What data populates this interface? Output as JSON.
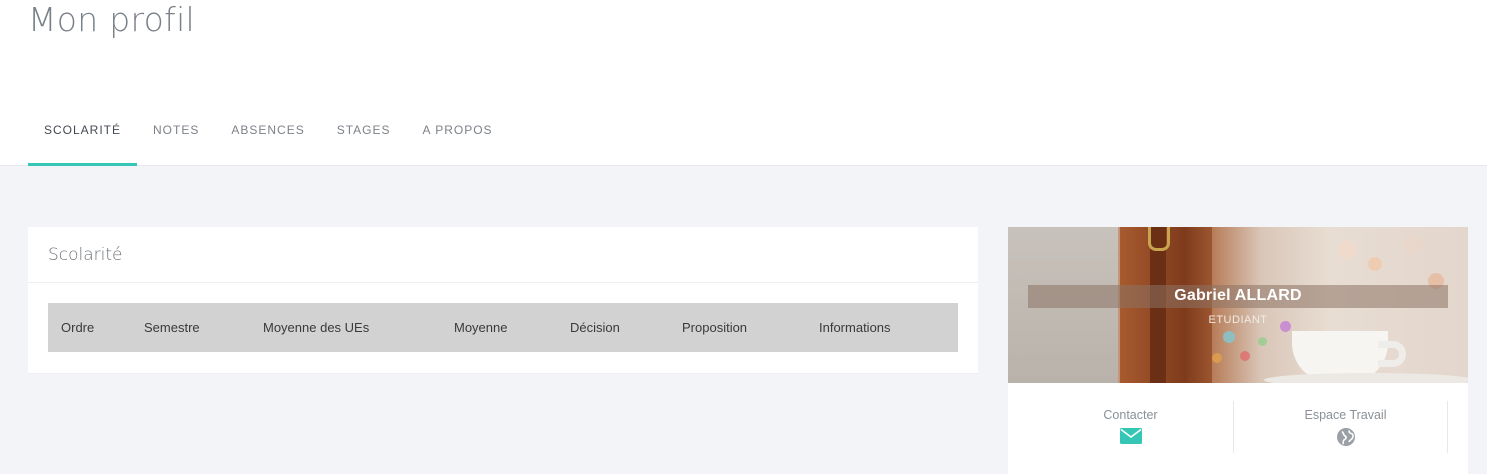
{
  "page": {
    "title": "Mon profil"
  },
  "tabs": [
    {
      "label": "SCOLARITÉ",
      "active": true
    },
    {
      "label": "NOTES",
      "active": false
    },
    {
      "label": "ABSENCES",
      "active": false
    },
    {
      "label": "STAGES",
      "active": false
    },
    {
      "label": "A PROPOS",
      "active": false
    }
  ],
  "scolarite": {
    "title": "Scolarité",
    "columns": [
      "Ordre",
      "Semestre",
      "Moyenne des UEs",
      "Moyenne",
      "Décision",
      "Proposition",
      "Informations"
    ],
    "rows": []
  },
  "profile": {
    "name": "Gabriel ALLARD",
    "role": "ETUDIANT",
    "actions": [
      {
        "label": "Contacter",
        "icon": "envelope-icon",
        "color": "#36c6b5"
      },
      {
        "label": "Espace Travail",
        "icon": "globe-icon",
        "color": "#9aa0a6"
      }
    ]
  },
  "colors": {
    "accent": "#36c6b5",
    "table_header": "#d2d2d2",
    "background": "#f3f4f7"
  }
}
